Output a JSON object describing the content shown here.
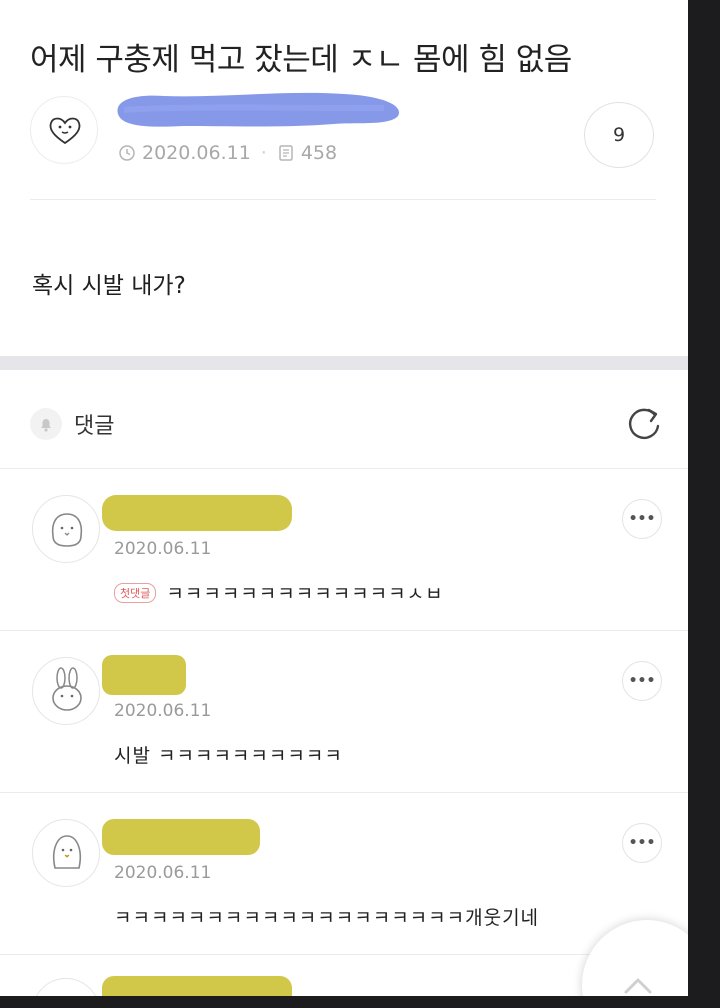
{
  "post": {
    "title": "어제 구충제 먹고 잤는데 ㅈㄴ 몸에 힘 없음",
    "date": "2020.06.11",
    "views": "458",
    "comment_count": "9",
    "body": "혹시 시발 내가?"
  },
  "comments_section": {
    "label": "댓글"
  },
  "comments": [
    {
      "date": "2020.06.11",
      "badge": "첫댓글",
      "text": "ㅋㅋㅋㅋㅋㅋㅋㅋㅋㅋㅋㅋㅋㅅㅂ"
    },
    {
      "date": "2020.06.11",
      "text": "시발 ㅋㅋㅋㅋㅋㅋㅋㅋㅋㅋ"
    },
    {
      "date": "2020.06.11",
      "text": "ㅋㅋㅋㅋㅋㅋㅋㅋㅋㅋㅋㅋㅋㅋㅋㅋㅋㅋㅋ개웃기네"
    }
  ],
  "colors": {
    "redact_blue": "#7c8fe6",
    "redact_yellow": "#c9be2a",
    "first_badge": "#e05a5a"
  }
}
